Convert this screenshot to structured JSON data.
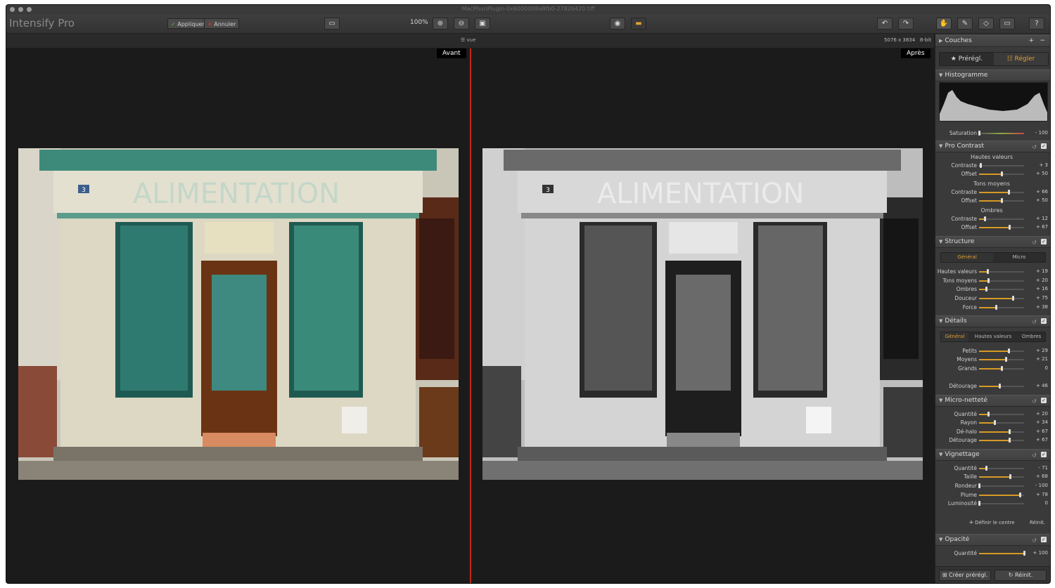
{
  "window": {
    "title": "MacPhunPlugin-0x6000008a8fb0-27826420.tiff"
  },
  "toolbar": {
    "app_name": "Intensify Pro",
    "apply_label": "Appliquer",
    "cancel_label": "Annuler",
    "zoom_level": "100%"
  },
  "canvas": {
    "view_label": "vue",
    "image_size": "5076 x 3834",
    "bit_depth": "8-bit",
    "before_label": "Avant",
    "after_label": "Après",
    "sign_text": "ALIMENTATION",
    "house_number": "3"
  },
  "panel": {
    "layers_title": "Couches",
    "tab_presets": "Prérégl.",
    "tab_adjust": "Régler",
    "histogram_title": "Histogramme",
    "saturation": {
      "label": "Saturation",
      "value": "- 100",
      "level": 0.0
    },
    "pro_contrast": {
      "title": "Pro Contrast",
      "highlights_label": "Hautes valeurs",
      "midtones_label": "Tons moyens",
      "shadows_label": "Ombres",
      "rows": [
        {
          "label": "Contraste",
          "value": "+ 3",
          "level": 0.03
        },
        {
          "label": "Offset",
          "value": "+ 50",
          "level": 0.5
        },
        {
          "label": "Contraste",
          "value": "+ 66",
          "level": 0.66
        },
        {
          "label": "Offset",
          "value": "+ 50",
          "level": 0.5
        },
        {
          "label": "Contraste",
          "value": "+ 12",
          "level": 0.12
        },
        {
          "label": "Offset",
          "value": "+ 67",
          "level": 0.67
        }
      ]
    },
    "structure": {
      "title": "Structure",
      "tabs": [
        "Général",
        "Micro"
      ],
      "rows": [
        {
          "label": "Hautes valeurs",
          "value": "+ 19",
          "level": 0.19
        },
        {
          "label": "Tons moyens",
          "value": "+ 20",
          "level": 0.2
        },
        {
          "label": "Ombres",
          "value": "+ 16",
          "level": 0.16
        },
        {
          "label": "Douceur",
          "value": "+ 75",
          "level": 0.75
        },
        {
          "label": "Force",
          "value": "+ 38",
          "level": 0.38
        }
      ]
    },
    "details": {
      "title": "Détails",
      "tabs": [
        "Général",
        "Hautes valeurs",
        "Ombres"
      ],
      "rows": [
        {
          "label": "Petits",
          "value": "+ 29",
          "level": 0.65
        },
        {
          "label": "Moyens",
          "value": "+ 21",
          "level": 0.6
        },
        {
          "label": "Grands",
          "value": "0",
          "level": 0.5
        },
        {
          "label": "Détourage",
          "value": "+ 46",
          "level": 0.46
        }
      ]
    },
    "micro_sharpness": {
      "title": "Micro-netteté",
      "rows": [
        {
          "label": "Quantité",
          "value": "+ 20",
          "level": 0.2
        },
        {
          "label": "Rayon",
          "value": "+ 34",
          "level": 0.34
        },
        {
          "label": "Dé-halo",
          "value": "+ 67",
          "level": 0.67
        },
        {
          "label": "Détourage",
          "value": "+ 67",
          "level": 0.67
        }
      ]
    },
    "vignette": {
      "title": "Vignettage",
      "rows": [
        {
          "label": "Quantité",
          "value": "- 71",
          "level": 0.15
        },
        {
          "label": "Taille",
          "value": "+ 68",
          "level": 0.68
        },
        {
          "label": "Rondeur",
          "value": "- 100",
          "level": 0.0
        },
        {
          "label": "Plume",
          "value": "+ 78",
          "level": 0.9
        },
        {
          "label": "Luminosité",
          "value": "0",
          "level": 0.0
        }
      ],
      "set_center": "Définir le centre",
      "reset": "Réinit."
    },
    "opacity": {
      "title": "Opacité",
      "rows": [
        {
          "label": "Quantité",
          "value": "+ 100",
          "level": 1.0
        }
      ]
    },
    "footer": {
      "create_preset": "Créer prérégl.",
      "reset": "Réinit."
    }
  }
}
